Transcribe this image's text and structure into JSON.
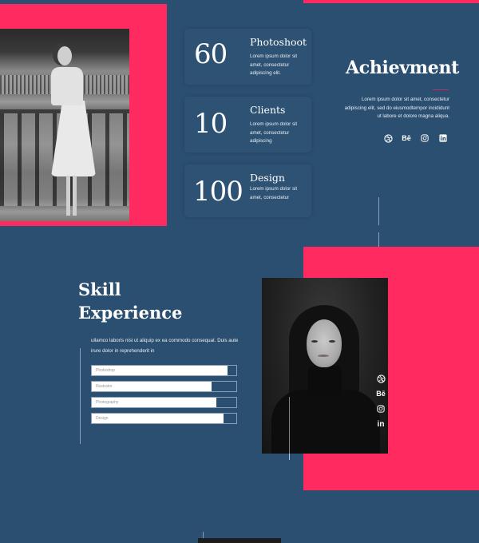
{
  "colors": {
    "background": "#2b4f70",
    "accent": "#ff2a5f",
    "card": "#2e5273",
    "text": "#ffffff"
  },
  "achievements": {
    "title": "Achievment",
    "description": "Lorem ipsum dolor sit amet, consectetur adipiscing elit, sed do eiusmodtempor incididunt ut labore et dolore magna aliqua.",
    "social_icons": [
      "dribbble-icon",
      "behance-icon",
      "instagram-icon",
      "linkedin-icon"
    ],
    "social_glyphs": {
      "behance": "Bē",
      "linkedin": "in"
    },
    "stats": [
      {
        "number": "60",
        "title": "Photoshoot",
        "description": "Lorem ipsum dolor sit amet, consectetur adipiscing elit."
      },
      {
        "number": "10",
        "title": "Clients",
        "description": "Lorem ipsum dolor sit amet, consectetur adipiscing"
      },
      {
        "number": "100",
        "title": "Design",
        "description": "Lorem ipsum dolor sit amet, consectetur"
      }
    ]
  },
  "skills": {
    "title_line1": "Skill",
    "title_line2": "Experience",
    "description": "ullamco laboris nisi ut aliquip ex ea commodo consequat. Duis aute irure dolor in reprehenderit in",
    "bars": [
      {
        "label": "Photoshop",
        "percent": 94
      },
      {
        "label": "Illustrator",
        "percent": 83
      },
      {
        "label": "Photography",
        "percent": 86
      },
      {
        "label": "Design",
        "percent": 91
      }
    ]
  },
  "profile": {
    "social_icons": [
      "dribbble-icon",
      "behance-icon",
      "instagram-icon",
      "linkedin-icon"
    ]
  }
}
